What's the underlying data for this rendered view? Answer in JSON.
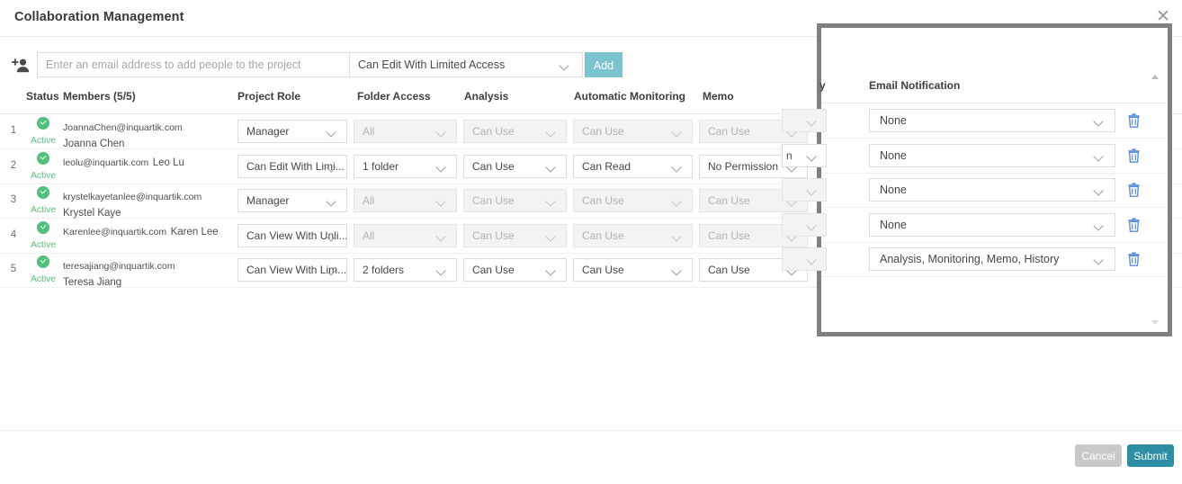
{
  "dialog": {
    "title": "Collaboration Management",
    "close_icon": "close-icon"
  },
  "invite": {
    "add_person_icon": "add-person-icon",
    "email_placeholder": "Enter an email address to add people to the project",
    "email_value": "",
    "role_value": "Can Edit With Limited Access",
    "add_label": "Add"
  },
  "table": {
    "headers": {
      "status": "Status",
      "members": "Members (5/5)",
      "project_role": "Project Role",
      "folder_access": "Folder Access",
      "analysis": "Analysis",
      "automatic_monitoring": "Automatic Monitoring",
      "memo": "Memo"
    },
    "rows": [
      {
        "index": "1",
        "status": "Active",
        "email": "JoannaChen@inquartik.com",
        "name": "Joanna Chen",
        "project_role": "Manager",
        "project_role_disabled": false,
        "folder_access": "All",
        "folder_access_disabled": true,
        "analysis": "Can Use",
        "analysis_disabled": true,
        "monitoring": "Can Use",
        "monitoring_disabled": true,
        "memo": "Can Use",
        "memo_disabled": true,
        "history_stub": "",
        "history_disabled": true,
        "email_notification": "None"
      },
      {
        "index": "2",
        "status": "Active",
        "email": "leolu@inquartik.com",
        "name": "Leo Lu",
        "project_role": "Can Edit With Limi...",
        "project_role_disabled": false,
        "folder_access": "1 folder",
        "folder_access_disabled": false,
        "analysis": "Can Use",
        "analysis_disabled": false,
        "monitoring": "Can Read",
        "monitoring_disabled": false,
        "memo": "No Permission",
        "memo_disabled": false,
        "history_stub": "n",
        "history_disabled": false,
        "email_notification": "None"
      },
      {
        "index": "3",
        "status": "Active",
        "email": "krystelkayetanlee@inquartik.com",
        "name": "Krystel Kaye",
        "project_role": "Manager",
        "project_role_disabled": false,
        "folder_access": "All",
        "folder_access_disabled": true,
        "analysis": "Can Use",
        "analysis_disabled": true,
        "monitoring": "Can Use",
        "monitoring_disabled": true,
        "memo": "Can Use",
        "memo_disabled": true,
        "history_stub": "",
        "history_disabled": true,
        "email_notification": "None"
      },
      {
        "index": "4",
        "status": "Active",
        "email": "Karenlee@inquartik.com",
        "name": "Karen Lee",
        "project_role": "Can View With Unli...",
        "project_role_disabled": false,
        "folder_access": "All",
        "folder_access_disabled": true,
        "analysis": "Can Use",
        "analysis_disabled": true,
        "monitoring": "Can Use",
        "monitoring_disabled": true,
        "memo": "Can Use",
        "memo_disabled": true,
        "history_stub": "",
        "history_disabled": true,
        "email_notification": "None"
      },
      {
        "index": "5",
        "status": "Active",
        "email": "teresajiang@inquartik.com",
        "name": "Teresa Jiang",
        "project_role": "Can View With Lim...",
        "project_role_disabled": false,
        "folder_access": "2 folders",
        "folder_access_disabled": false,
        "analysis": "Can Use",
        "analysis_disabled": false,
        "monitoring": "Can Use",
        "monitoring_disabled": false,
        "memo": "Can Use",
        "memo_disabled": false,
        "history_stub": "",
        "history_disabled": true,
        "email_notification": "Analysis, Monitoring, Memo, History"
      }
    ]
  },
  "panel": {
    "hidden_column_header_fragment": "y",
    "email_notification_header": "Email Notification",
    "delete_icon": "trash-icon",
    "scroll_up_icon": "scroll-up-arrow-icon",
    "scroll_down_icon": "scroll-down-arrow-icon"
  },
  "footer": {
    "cancel_label": "Cancel",
    "submit_label": "Submit"
  },
  "colors": {
    "add_button": "#7cc3d0",
    "submit_button": "#2e8fa4",
    "cancel_button": "#c9c9c9",
    "status_active": "#51c07a",
    "trash_icon": "#5b8fd6",
    "panel_border": "#808080"
  }
}
